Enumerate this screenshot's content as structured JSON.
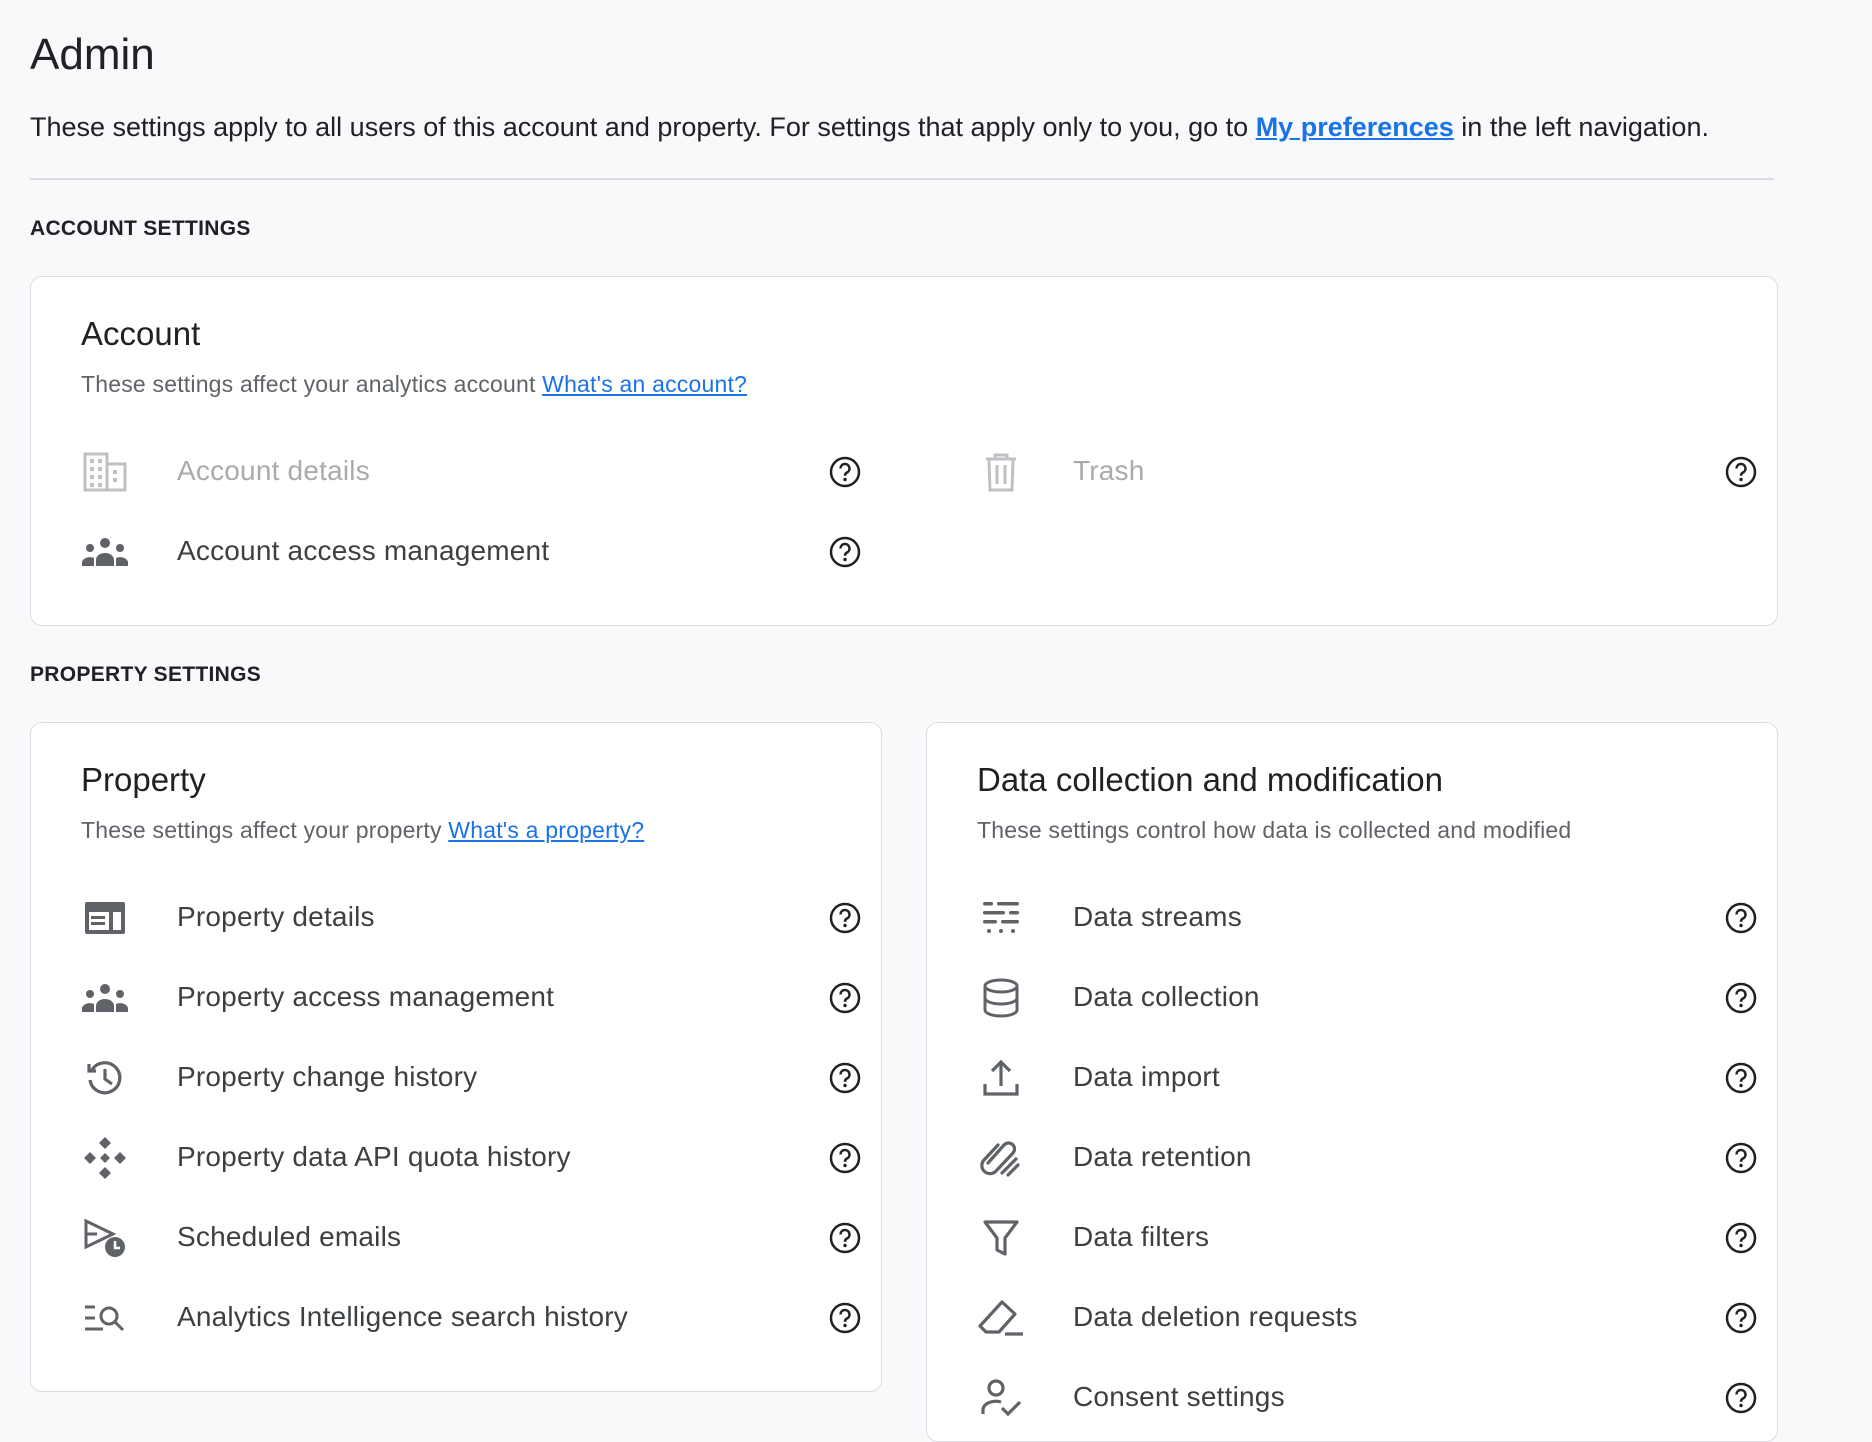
{
  "header": {
    "title": "Admin",
    "intro_before": "These settings apply to all users of this account and property. For settings that apply only to you, go to ",
    "intro_link": "My preferences",
    "intro_after": " in the left navigation."
  },
  "account_section": {
    "label": "ACCOUNT SETTINGS",
    "card": {
      "title": "Account",
      "desc": "These settings affect your analytics account ",
      "desc_link": "What's an account?",
      "items": [
        {
          "label": "Account details",
          "icon": "building-icon",
          "disabled": true
        },
        {
          "label": "Trash",
          "icon": "trash-icon",
          "disabled": true
        },
        {
          "label": "Account access management",
          "icon": "group-icon",
          "disabled": false
        }
      ]
    }
  },
  "property_section": {
    "label": "PROPERTY SETTINGS",
    "property_card": {
      "title": "Property",
      "desc": "These settings affect your property ",
      "desc_link": "What's a property?",
      "items": [
        {
          "label": "Property details",
          "icon": "web-layout-icon"
        },
        {
          "label": "Property access management",
          "icon": "group-icon"
        },
        {
          "label": "Property change history",
          "icon": "history-icon"
        },
        {
          "label": "Property data API quota history",
          "icon": "api-icon"
        },
        {
          "label": "Scheduled emails",
          "icon": "schedule-send-icon"
        },
        {
          "label": "Analytics Intelligence search history",
          "icon": "manage-search-icon"
        }
      ]
    },
    "data_card": {
      "title": "Data collection and modification",
      "desc": "These settings control how data is collected and modified",
      "items": [
        {
          "label": "Data streams",
          "icon": "data-streams-icon"
        },
        {
          "label": "Data collection",
          "icon": "database-icon"
        },
        {
          "label": "Data import",
          "icon": "upload-icon"
        },
        {
          "label": "Data retention",
          "icon": "retention-icon"
        },
        {
          "label": "Data filters",
          "icon": "filter-icon"
        },
        {
          "label": "Data deletion requests",
          "icon": "eraser-icon"
        },
        {
          "label": "Consent settings",
          "icon": "consent-icon"
        }
      ]
    }
  },
  "colors": {
    "link": "#1a73e8",
    "icon": "#5f6368",
    "disabled": "#a8abae",
    "border": "#dadce0"
  }
}
